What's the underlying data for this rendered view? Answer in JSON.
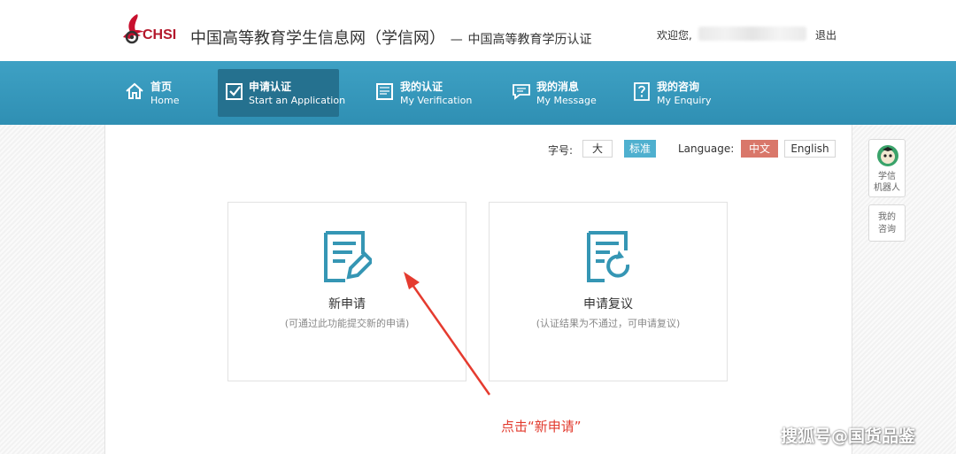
{
  "header": {
    "logo_text": "CHSI",
    "site_title": "中国高等教育学生信息网（学信网）",
    "site_subtitle_dash": "—",
    "site_subtitle": "中国高等教育学历认证",
    "welcome": "欢迎您,",
    "logout": "退出"
  },
  "nav": {
    "items": [
      {
        "zh": "首页",
        "en": "Home",
        "icon": "home-icon"
      },
      {
        "zh": "申请认证",
        "en": "Start an Application",
        "icon": "checkbox-icon",
        "active": true
      },
      {
        "zh": "我的认证",
        "en": "My Verification",
        "icon": "verification-icon"
      },
      {
        "zh": "我的消息",
        "en": "My Message",
        "icon": "message-icon"
      },
      {
        "zh": "我的咨询",
        "en": "My Enquiry",
        "icon": "question-icon"
      }
    ]
  },
  "toolbar": {
    "font_size_label": "字号:",
    "font_large": "大",
    "font_standard": "标准",
    "language_label": "Language:",
    "lang_zh": "中文",
    "lang_en": "English"
  },
  "cards": [
    {
      "title": "新申请",
      "desc": "(可通过此功能提交新的申请)",
      "icon": "edit-document-icon"
    },
    {
      "title": "申请复议",
      "desc": "(认证结果为不通过，可申请复议)",
      "icon": "refresh-document-icon"
    }
  ],
  "side_tools": {
    "robot": "学信机器人",
    "robot_line1": "学信",
    "robot_line2": "机器人",
    "enquiry_line1": "我的",
    "enquiry_line2": "咨询"
  },
  "annotation": "点击“新申请”",
  "watermark": "搜狐号@国货品鉴",
  "colors": {
    "nav_bg": "#3a9cc0",
    "nav_active": "#25718f",
    "accent_blue": "#4fb0cf",
    "accent_red": "#d9776a",
    "icon_teal": "#3596b4",
    "annotation_red": "#e23b2e"
  }
}
